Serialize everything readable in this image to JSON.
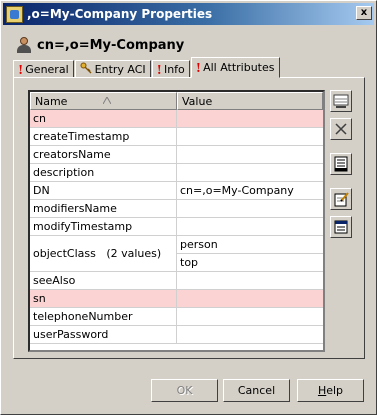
{
  "window": {
    "title": ",o=My-Company Properties",
    "close_glyph": "x"
  },
  "header": {
    "title": "cn=,o=My-Company"
  },
  "tabs": [
    {
      "label": "General",
      "marker": "!"
    },
    {
      "label": "Entry ACI",
      "marker": "key"
    },
    {
      "label": "Info",
      "marker": "!"
    },
    {
      "label": "All Attributes",
      "marker": "!",
      "active": true
    }
  ],
  "table": {
    "columns": [
      "Name",
      "Value"
    ],
    "rows": [
      {
        "name": "cn",
        "values": [
          ""
        ],
        "highlight": true
      },
      {
        "name": "createTimestamp",
        "values": [
          ""
        ]
      },
      {
        "name": "creatorsName",
        "values": [
          ""
        ]
      },
      {
        "name": "description",
        "values": [
          ""
        ]
      },
      {
        "name": "DN",
        "values": [
          "cn=,o=My-Company"
        ]
      },
      {
        "name": "modifiersName",
        "values": [
          ""
        ]
      },
      {
        "name": "modifyTimestamp",
        "values": [
          ""
        ]
      },
      {
        "name": "objectClass   (2 values)",
        "values": [
          "person",
          "top"
        ]
      },
      {
        "name": "seeAlso",
        "values": [
          ""
        ]
      },
      {
        "name": "sn",
        "values": [
          ""
        ],
        "highlight": true
      },
      {
        "name": "telephoneNumber",
        "values": [
          ""
        ]
      },
      {
        "name": "userPassword",
        "values": [
          ""
        ]
      }
    ]
  },
  "side_buttons": [
    "add-attribute-icon",
    "delete-icon",
    "edit-values-icon",
    "edit-icon",
    "properties-list-icon"
  ],
  "buttons": {
    "ok": "OK",
    "cancel": "Cancel",
    "help_u": "H",
    "help_rest": "elp"
  },
  "colors": {
    "highlight_row": "#fbd3d3",
    "title_gradient_start": "#0a246a",
    "marker_red": "#e00000"
  }
}
